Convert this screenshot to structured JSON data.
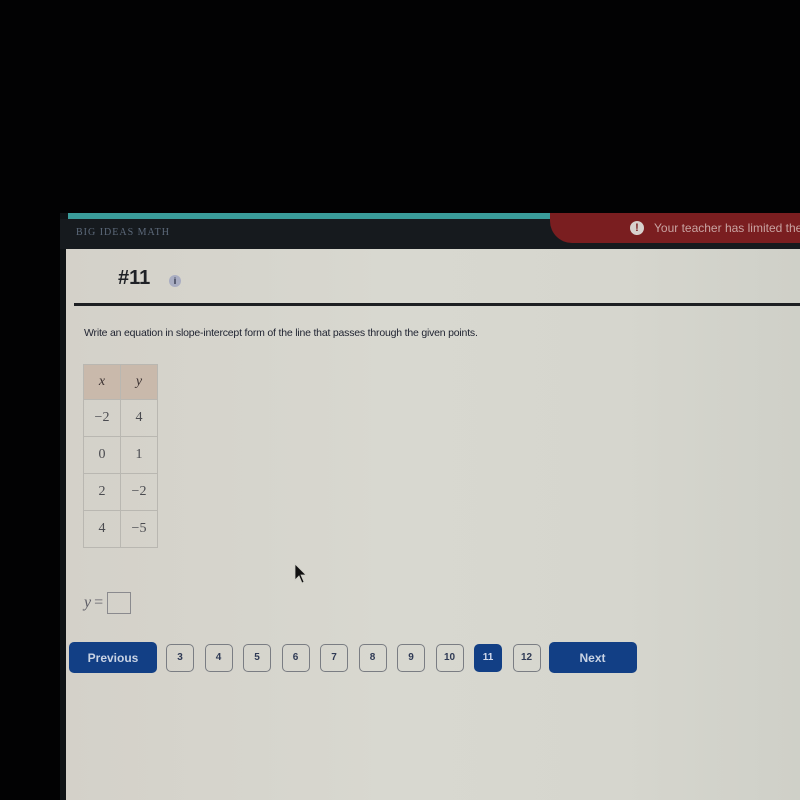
{
  "app": {
    "brand": "BIG IDEAS MATH",
    "alert_text": "Your teacher has limited the",
    "alert_icon": "exclamation-icon",
    "colors": {
      "primary": "#123f85",
      "alert": "#7a1e20",
      "progress": "#3a9c9a"
    }
  },
  "question": {
    "title": "#11",
    "info_icon": "i",
    "prompt": "Write an equation in slope-intercept form of the line that passes through the given points.",
    "table": {
      "headers": [
        "x",
        "y"
      ],
      "rows": [
        [
          "−2",
          "4"
        ],
        [
          "0",
          "1"
        ],
        [
          "2",
          "−2"
        ],
        [
          "4",
          "−5"
        ]
      ]
    },
    "answer": {
      "variable": "y",
      "equals": "=",
      "value": ""
    }
  },
  "navigation": {
    "previous_label": "Previous",
    "next_label": "Next",
    "pages": [
      "3",
      "4",
      "5",
      "6",
      "7",
      "8",
      "9",
      "10",
      "11",
      "12"
    ],
    "current_page": "11"
  }
}
